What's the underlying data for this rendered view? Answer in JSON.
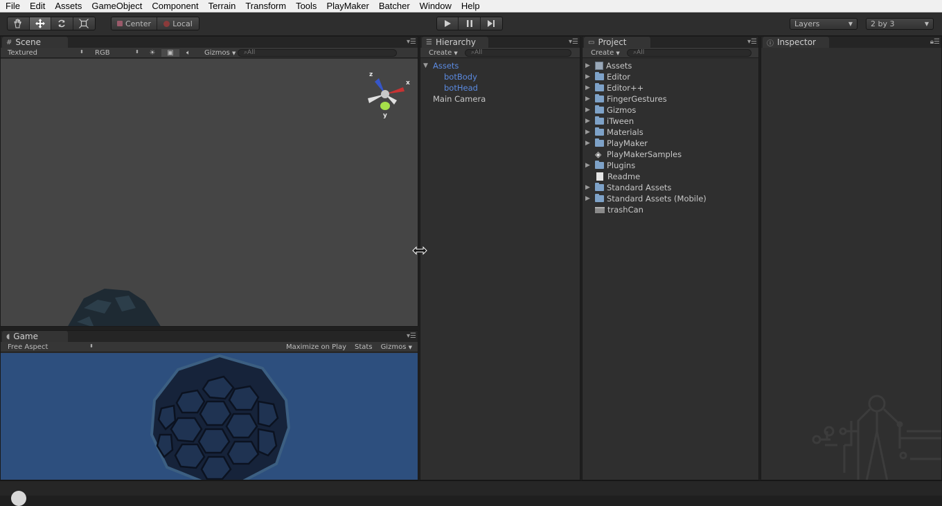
{
  "menu": [
    "File",
    "Edit",
    "Assets",
    "GameObject",
    "Component",
    "Terrain",
    "Transform",
    "Tools",
    "PlayMaker",
    "Batcher",
    "Window",
    "Help"
  ],
  "toolbar": {
    "pivot_center": "Center",
    "pivot_local": "Local",
    "layers": "Layers",
    "layout": "2 by 3"
  },
  "scene": {
    "tab": "Scene",
    "render_mode": "Textured",
    "color_mode": "RGB",
    "gizmos": "Gizmos",
    "search": "All",
    "axis_x": "x",
    "axis_y": "y",
    "axis_z": "z"
  },
  "game": {
    "tab": "Game",
    "aspect": "Free Aspect",
    "maximize": "Maximize on Play",
    "stats": "Stats",
    "gizmos": "Gizmos"
  },
  "hierarchy": {
    "tab": "Hierarchy",
    "create": "Create",
    "search": "All",
    "items": [
      {
        "label": "Assets",
        "depth": 0,
        "blue": true,
        "expanded": true
      },
      {
        "label": "botBody",
        "depth": 1,
        "blue": true
      },
      {
        "label": "botHead",
        "depth": 1,
        "blue": true
      },
      {
        "label": "Main Camera",
        "depth": 0,
        "blue": false
      }
    ]
  },
  "project": {
    "tab": "Project",
    "create": "Create",
    "search": "All",
    "items": [
      {
        "label": "Assets",
        "icon": "package-icon",
        "arrow": true
      },
      {
        "label": "Editor",
        "icon": "folder-icon",
        "arrow": true
      },
      {
        "label": "Editor++",
        "icon": "folder-icon",
        "arrow": true
      },
      {
        "label": "FingerGestures",
        "icon": "folder-icon",
        "arrow": true
      },
      {
        "label": "Gizmos",
        "icon": "folder-icon",
        "arrow": true
      },
      {
        "label": "iTween",
        "icon": "folder-icon",
        "arrow": true
      },
      {
        "label": "Materials",
        "icon": "folder-icon",
        "arrow": true
      },
      {
        "label": "PlayMaker",
        "icon": "folder-icon",
        "arrow": true
      },
      {
        "label": "PlayMakerSamples",
        "icon": "unity-scene-icon",
        "arrow": false
      },
      {
        "label": "Plugins",
        "icon": "folder-icon",
        "arrow": true
      },
      {
        "label": "Readme",
        "icon": "document-icon",
        "arrow": false
      },
      {
        "label": "Standard Assets",
        "icon": "folder-icon",
        "arrow": true
      },
      {
        "label": "Standard Assets (Mobile)",
        "icon": "folder-icon",
        "arrow": true
      },
      {
        "label": "trashCan",
        "icon": "model-icon",
        "arrow": false
      }
    ]
  },
  "inspector": {
    "tab": "Inspector"
  },
  "colors": {
    "game_bg": "#2d4f7e",
    "scene_bg": "#454545",
    "selected_blue": "#5b8ae0"
  }
}
